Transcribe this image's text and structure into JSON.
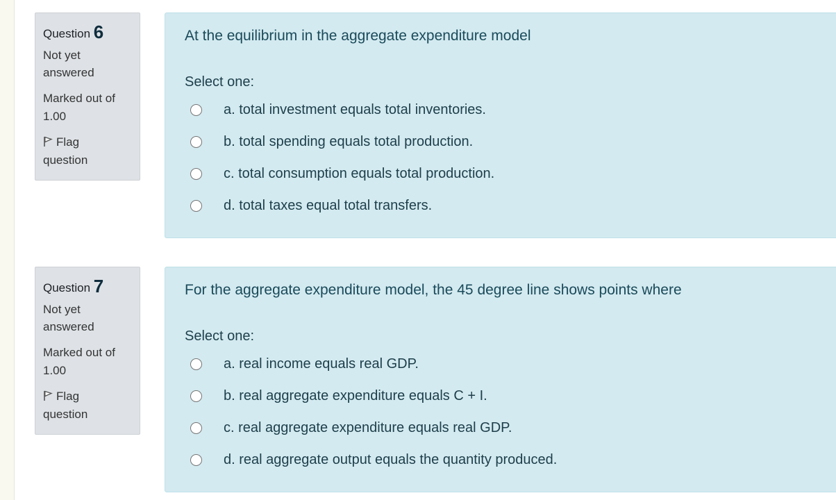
{
  "questions": [
    {
      "label": "Question",
      "number": "6",
      "state_line1": "Not yet",
      "state_line2": "answered",
      "grade_line1": "Marked out of",
      "grade_line2": "1.00",
      "flag_line1": "Flag",
      "flag_line2": "question",
      "text": "At the equilibrium in the aggregate expenditure model",
      "prompt": "Select one:",
      "options": [
        "a. total investment equals total inventories.",
        "b. total spending equals total production.",
        "c. total consumption equals total production.",
        "d. total taxes equal total transfers."
      ]
    },
    {
      "label": "Question",
      "number": "7",
      "state_line1": "Not yet",
      "state_line2": "answered",
      "grade_line1": "Marked out of",
      "grade_line2": "1.00",
      "flag_line1": "Flag",
      "flag_line2": "question",
      "text": "For the aggregate expenditure model, the 45 degree line shows points where",
      "prompt": "Select one:",
      "options": [
        "a. real income equals real GDP.",
        "b. real aggregate expenditure equals C + I.",
        "c. real aggregate expenditure equals real GDP.",
        "d. real aggregate output equals the quantity produced."
      ]
    }
  ],
  "icons": {
    "flag": "flag-icon"
  },
  "colors": {
    "info_bg": "#dee2e6",
    "content_bg": "#d3eaf0",
    "text": "#1d3e4a"
  }
}
